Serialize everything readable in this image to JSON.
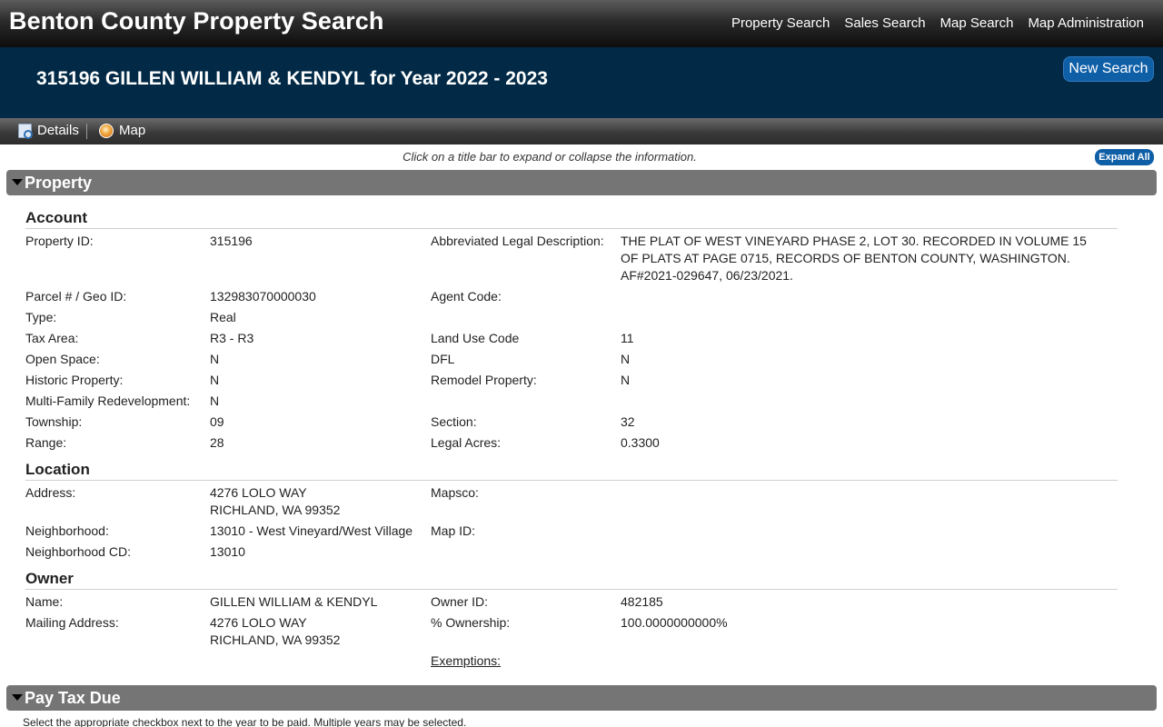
{
  "site": {
    "title": "Benton County Property Search",
    "nav": [
      "Property Search",
      "Sales Search",
      "Map Search",
      "Map Administration"
    ]
  },
  "header": {
    "heading": "315196 GILLEN WILLIAM & KENDYL for Year 2022 - 2023",
    "new_search": "New Search"
  },
  "subnav": {
    "details": "Details",
    "map": "Map"
  },
  "hint": "Click on a title bar to expand or collapse the information.",
  "expand_all": "Expand All",
  "sections": {
    "property": "Property",
    "pay_tax_due": "Pay Tax Due"
  },
  "account": {
    "title": "Account",
    "property_id_label": "Property ID:",
    "property_id": "315196",
    "legal_desc_label": "Abbreviated Legal Description:",
    "legal_desc": "THE PLAT OF WEST VINEYARD PHASE 2, LOT 30. RECORDED IN VOLUME 15 OF PLATS AT PAGE 0715, RECORDS OF BENTON COUNTY, WASHINGTON. AF#2021-029647, 06/23/2021.",
    "parcel_label": "Parcel # / Geo ID:",
    "parcel": "132983070000030",
    "agent_code_label": "Agent Code:",
    "type_label": "Type:",
    "type": "Real",
    "tax_area_label": "Tax Area:",
    "tax_area": "R3 - R3",
    "land_use_label": "Land Use Code",
    "land_use": "11",
    "open_space_label": "Open Space:",
    "open_space": "N",
    "dfl_label": "DFL",
    "dfl": "N",
    "historic_label": "Historic Property:",
    "historic": "N",
    "remodel_label": "Remodel Property:",
    "remodel": "N",
    "multifamily_label": "Multi-Family Redevelopment:",
    "multifamily": "N",
    "township_label": "Township:",
    "township": "09",
    "section_label": "Section:",
    "section": "32",
    "range_label": "Range:",
    "range": "28",
    "legal_acres_label": "Legal Acres:",
    "legal_acres": "0.3300"
  },
  "location": {
    "title": "Location",
    "address_label": "Address:",
    "address_line1": "4276 LOLO WAY",
    "address_line2": "RICHLAND, WA 99352",
    "mapsco_label": "Mapsco:",
    "neighborhood_label": "Neighborhood:",
    "neighborhood": "13010 - West Vineyard/West Village",
    "map_id_label": "Map ID:",
    "neighborhood_cd_label": "Neighborhood CD:",
    "neighborhood_cd": "13010"
  },
  "owner": {
    "title": "Owner",
    "name_label": "Name:",
    "name": "GILLEN WILLIAM & KENDYL",
    "owner_id_label": "Owner ID:",
    "owner_id": "482185",
    "mailing_label": "Mailing Address:",
    "mailing_line1": "4276 LOLO WAY",
    "mailing_line2": "RICHLAND, WA 99352",
    "ownership_label": "% Ownership:",
    "ownership": "100.0000000000%",
    "exemptions_label": "Exemptions:"
  },
  "pay_note": "Select the appropriate checkbox next to the year to be paid. Multiple years may be selected."
}
